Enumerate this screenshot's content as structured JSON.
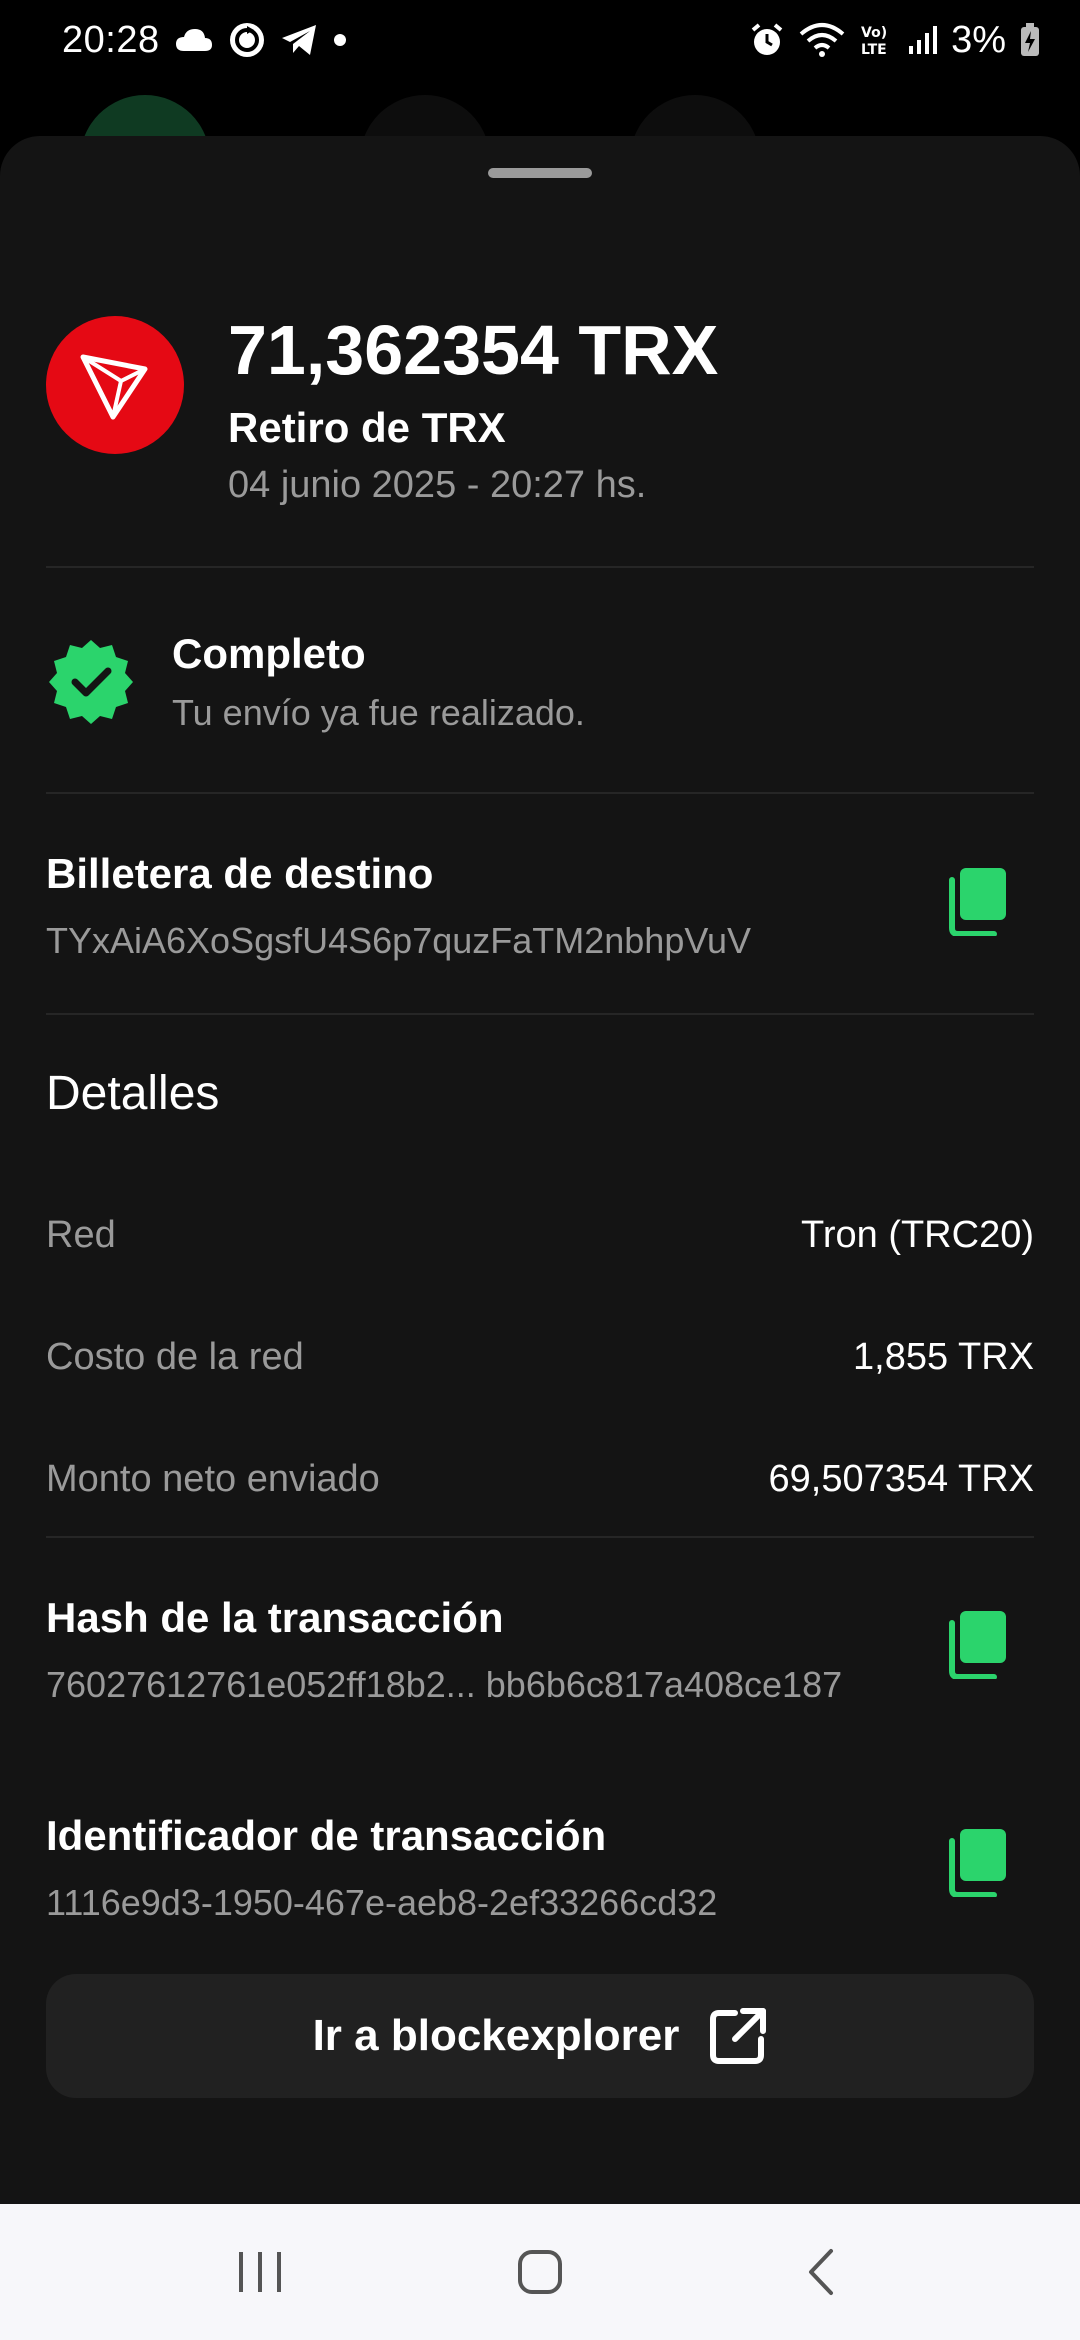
{
  "status_bar": {
    "time": "20:28",
    "battery": "3%",
    "left_icons": [
      "cloud-icon",
      "sync-icon",
      "telegram-icon",
      "dot-icon"
    ],
    "right_icons": [
      "alarm-icon",
      "wifi-icon",
      "volte-icon",
      "signal-icon",
      "battery-charging-icon"
    ]
  },
  "header": {
    "token_icon": "tron-logo",
    "amount": "71,362354 TRX",
    "title": "Retiro de TRX",
    "date": "04 junio 2025 - 20:27 hs."
  },
  "status": {
    "icon": "check-badge-icon",
    "title": "Completo",
    "subtitle": "Tu envío ya fue realizado."
  },
  "destination": {
    "label": "Billetera de destino",
    "value": "TYxAiA6XoSgsfU4S6p7quzFaTM2nbhpVuV"
  },
  "details": {
    "title": "Detalles",
    "rows": [
      {
        "key": "Red",
        "value": "Tron (TRC20)"
      },
      {
        "key": "Costo de la red",
        "value": "1,855 TRX"
      },
      {
        "key": "Monto neto enviado",
        "value": "69,507354 TRX"
      }
    ]
  },
  "hash": {
    "label": "Hash de la transacción",
    "value": "76027612761e052ff18b2... bb6b6c817a408ce187"
  },
  "identifier": {
    "label": "Identificador de transacción",
    "value": "1116e9d3-1950-467e-aeb8-2ef33266cd32"
  },
  "explorer_button": {
    "label": "Ir a blockexplorer",
    "icon": "external-link-icon"
  },
  "nav": {
    "items": [
      "recent-apps-icon",
      "home-icon",
      "back-icon"
    ]
  },
  "colors": {
    "sheet_bg": "#141414",
    "accent_green": "#2bd46c",
    "tron_red": "#e50914",
    "muted_text": "#9a9a9a"
  }
}
